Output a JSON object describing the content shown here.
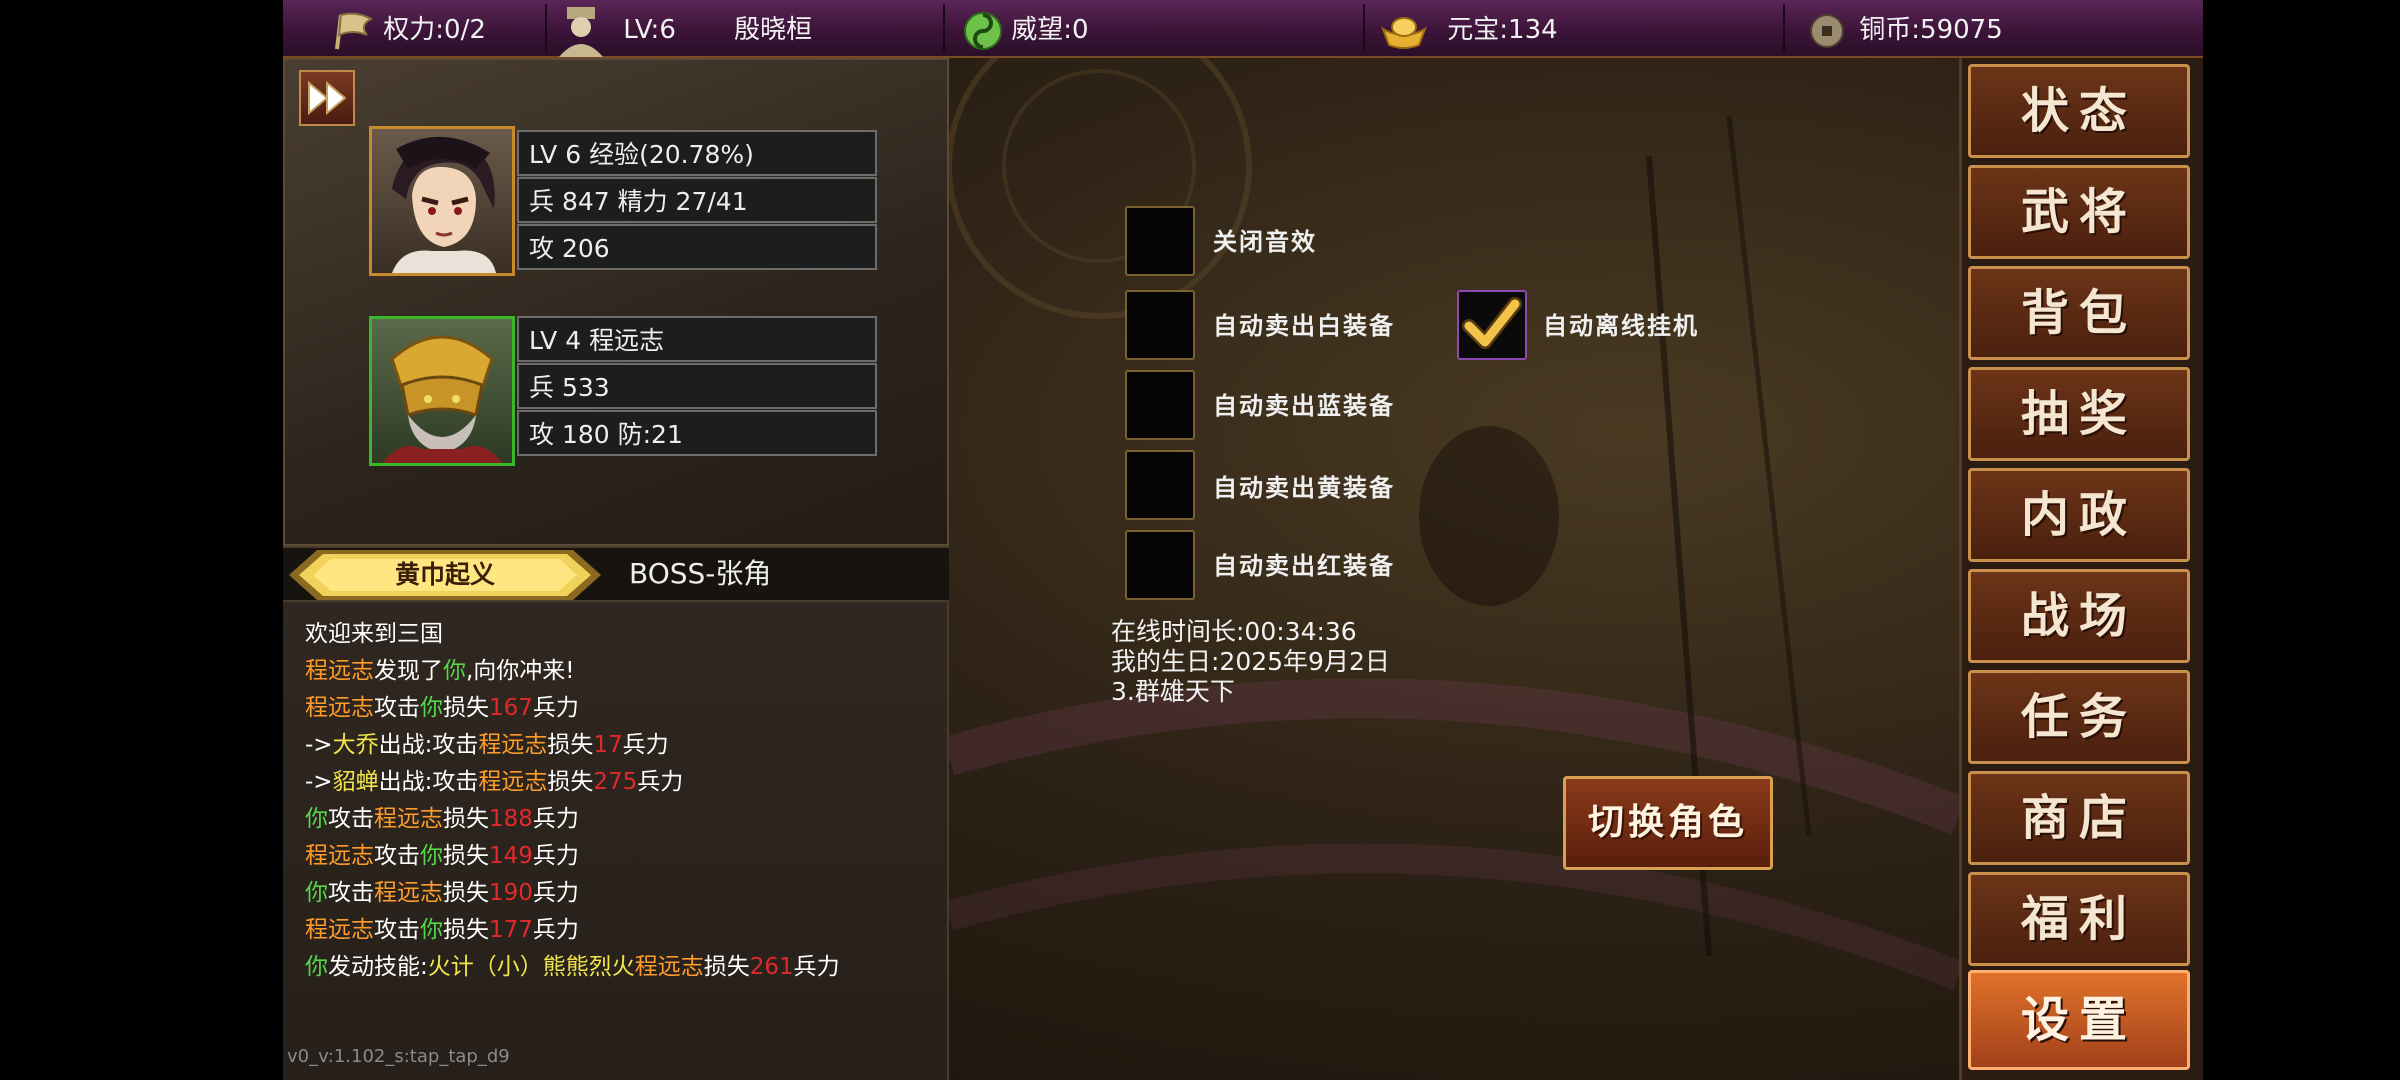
{
  "topbar": {
    "power": "权力:0/2",
    "level": "LV:6",
    "player_name": "殷晓桓",
    "prestige": "威望:0",
    "yuanbao": "元宝:134",
    "copper": "铜币:59075"
  },
  "heroes": [
    {
      "row1": "LV 6 经验(20.78%)",
      "row2": "兵 847 精力 27/41",
      "row3": "攻 206"
    },
    {
      "row1": "LV 4  程远志",
      "row2": "兵 533",
      "row3": "攻 180 防:21"
    }
  ],
  "chapter": {
    "name": "黄巾起义",
    "boss": "BOSS-张角"
  },
  "log": {
    "welcome": "欢迎来到三国",
    "l2": [
      "程远志",
      "发现了",
      "你",
      ",向你冲来!"
    ],
    "l3": [
      "程远志",
      "攻击",
      "你",
      "损失",
      "167",
      "兵力"
    ],
    "l4": [
      "->",
      "大乔",
      "出战:攻击",
      "程远志",
      "损失",
      "17",
      "兵力"
    ],
    "l5": [
      "->",
      "貂蝉",
      "出战:攻击",
      "程远志",
      "损失",
      "275",
      "兵力"
    ],
    "l6": [
      "你",
      "攻击",
      "程远志",
      "损失",
      "188",
      "兵力"
    ],
    "l7": [
      "程远志",
      "攻击",
      "你",
      "损失",
      "149",
      "兵力"
    ],
    "l8": [
      "你",
      "攻击",
      "程远志",
      "损失",
      "190",
      "兵力"
    ],
    "l9": [
      "程远志",
      "攻击",
      "你",
      "损失",
      "177",
      "兵力"
    ],
    "l10": [
      "你",
      "发动技能:",
      "火计（小）熊熊烈火",
      "程远志",
      "损失",
      "261",
      "兵力"
    ]
  },
  "version": "v0_v:1.102_s:tap_tap_d9",
  "settings": {
    "mute": "关闭音效",
    "sell_white": "自动卖出白装备",
    "sell_blue": "自动卖出蓝装备",
    "sell_yellow": "自动卖出黄装备",
    "sell_red": "自动卖出红装备",
    "offline_idle": "自动离线挂机",
    "checked": {
      "mute": false,
      "sell_white": false,
      "sell_blue": false,
      "sell_yellow": false,
      "sell_red": false,
      "offline_idle": true
    }
  },
  "info": {
    "online": "在线时间长:00:34:36",
    "birthday": "我的生日:2025年9月2日",
    "server": "3.群雄天下"
  },
  "switch_role": "切换角色",
  "menu": [
    "状态",
    "武将",
    "背包",
    "抽奖",
    "内政",
    "战场",
    "任务",
    "商店",
    "福利",
    "设置"
  ],
  "active_menu": "设置",
  "colors": {
    "orange": "#ff9c2a",
    "green": "#54d84a",
    "red": "#e02a2a",
    "yellow": "#f2e64a",
    "topbar": "#3a1336"
  }
}
